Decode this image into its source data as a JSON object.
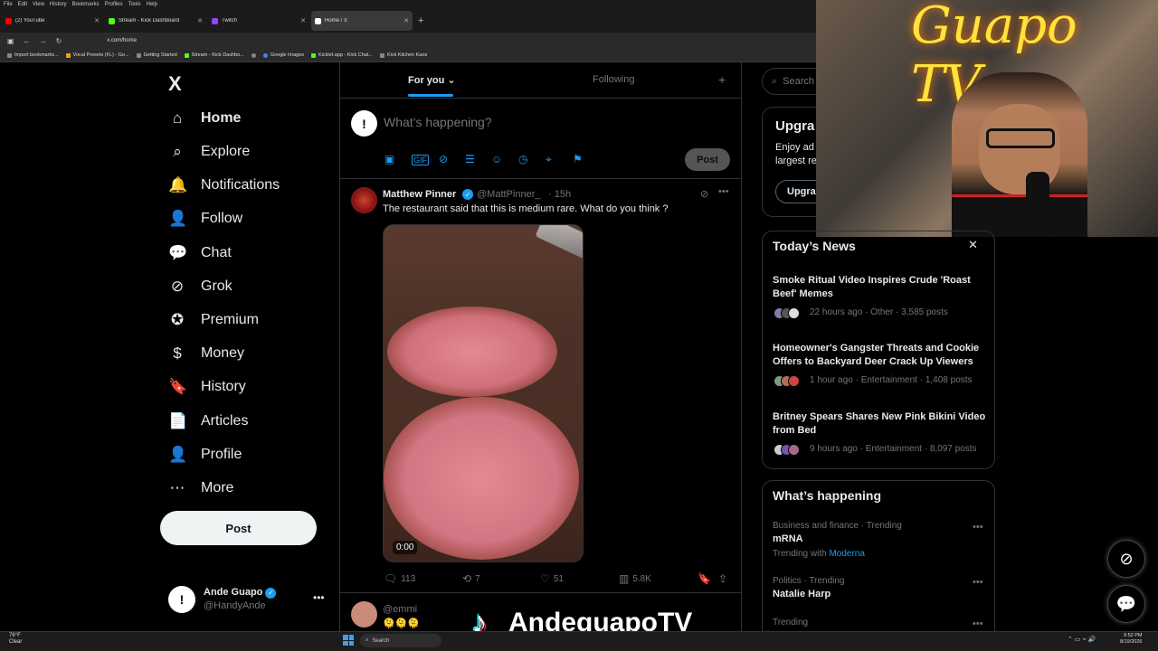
{
  "browser": {
    "menu": [
      "File",
      "Edit",
      "View",
      "History",
      "Bookmarks",
      "Profiles",
      "Tools",
      "Help"
    ],
    "tabs": [
      {
        "title": "(2) YouTube",
        "color": "#ff0000"
      },
      {
        "title": "Stream - Kick Dashboard",
        "color": "#53fc18"
      },
      {
        "title": "Twitch",
        "color": "#9146ff"
      },
      {
        "title": "Home / X",
        "color": "#ffffff"
      }
    ],
    "url": "x.com/home",
    "bookmarks": [
      "Import bookmarks...",
      "Vocal Presets (FL) - Go...",
      "Getting Started",
      "Stream - Kick Dashbo...",
      "",
      "Google Images",
      "Kicklet.app - Kick Chat...",
      "Kick Kitchen Kaos"
    ]
  },
  "nav": {
    "logo": "X",
    "items": [
      {
        "label": "Home",
        "icon": "⌂"
      },
      {
        "label": "Explore",
        "icon": "⌕"
      },
      {
        "label": "Notifications",
        "icon": "🔔"
      },
      {
        "label": "Follow",
        "icon": "👤"
      },
      {
        "label": "Chat",
        "icon": "💬"
      },
      {
        "label": "Grok",
        "icon": "⊘"
      },
      {
        "label": "Premium",
        "icon": "✪"
      },
      {
        "label": "Money",
        "icon": "$"
      },
      {
        "label": "History",
        "icon": "🔖"
      },
      {
        "label": "Articles",
        "icon": "📄"
      },
      {
        "label": "Profile",
        "icon": "👤"
      },
      {
        "label": "More",
        "icon": "⋯"
      }
    ],
    "post_label": "Post",
    "account": {
      "name": "Ande Guapo",
      "handle": "@HandyAnde",
      "avatar": "!",
      "more": "•••"
    }
  },
  "feed": {
    "tabs": {
      "for_you": "For you",
      "following": "Following",
      "plus": "+"
    },
    "compose": {
      "placeholder": "What’s happening?",
      "post": "Post",
      "avatar": "!"
    },
    "tweet": {
      "name": "Matthew Pinner",
      "handle": "@MattPinner_",
      "time": "· 15h",
      "text": "The restaurant said that this is medium rare. What do you think ?",
      "video_time": "0:00",
      "replies": "113",
      "reposts": "7",
      "likes": "51",
      "views": "5.8K"
    },
    "tweet2": {
      "handle": "@emmi",
      "emoji": "🫠🫠🫠"
    }
  },
  "right": {
    "search_placeholder": "Search",
    "upgrade": {
      "title": "Upgra",
      "text": "Enjoy ad largest re",
      "button": "Upgra"
    },
    "news": {
      "title": "Today’s News",
      "close": "✕",
      "items": [
        {
          "title": "Smoke Ritual Video Inspires Crude 'Roast Beef' Memes",
          "meta": "22 hours ago · Other · 3,585 posts"
        },
        {
          "title": "Homeowner's Gangster Threats and Cookie Offers to Backyard Deer Crack Up Viewers",
          "meta": "1 hour ago · Entertainment · 1,408 posts"
        },
        {
          "title": "Britney Spears Shares New Pink Bikini Video from Bed",
          "meta": "9 hours ago · Entertainment · 8,097 posts"
        }
      ]
    },
    "happening": {
      "title": "What’s happening",
      "trends": [
        {
          "category": "Business and finance · Trending",
          "name": "mRNA",
          "with_label": "Trending with",
          "with": "Moderna"
        },
        {
          "category": "Politics · Trending",
          "name": "Natalie Harp"
        },
        {
          "category": "Trending",
          "name": ""
        }
      ]
    }
  },
  "webcam": {
    "sign": "Guapo TV"
  },
  "overlay": {
    "tiktok_name": "AndeguapoTV"
  },
  "taskbar": {
    "temp": "76°F",
    "weather": "Clear",
    "search": "Search",
    "time": "9:52 PM",
    "date": "8/19/2026"
  }
}
